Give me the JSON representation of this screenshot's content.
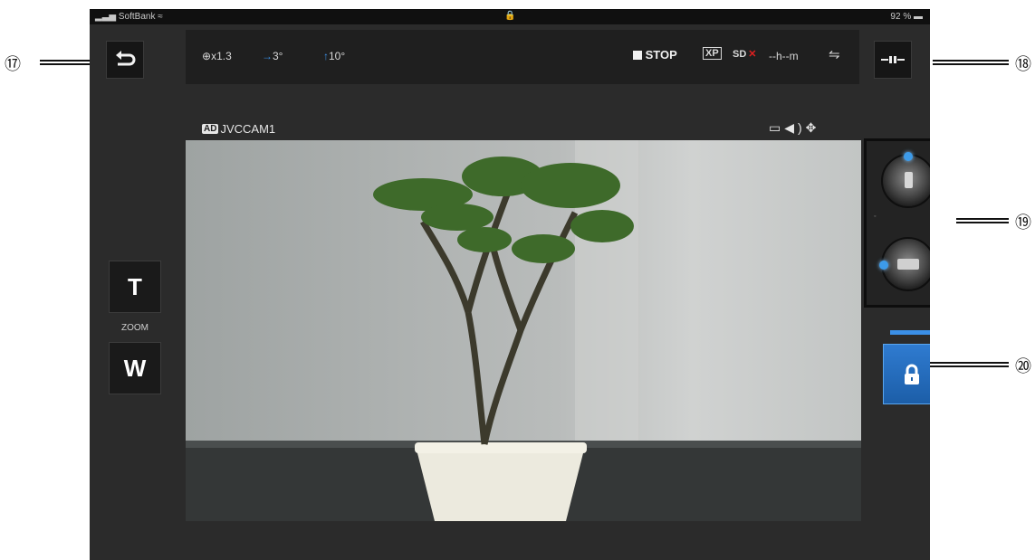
{
  "status_bar": {
    "carrier": "SoftBank",
    "battery": "92 %"
  },
  "toolbar": {
    "zoom": "x1.3",
    "pan": "3°",
    "tilt": "10°",
    "rec_state": "STOP",
    "rec_mode": "XP",
    "media": "SD",
    "remaining": "--h--m"
  },
  "camera": {
    "badge": "AD",
    "name": "JVCCAM1"
  },
  "zoom_control": {
    "tele_label": "T",
    "label": "ZOOM",
    "wide_label": "W"
  },
  "callouts": {
    "back": "⑰",
    "menu": "⑱",
    "dials": "⑲",
    "lock": "⑳"
  },
  "colors": {
    "accent": "#3b8fe6",
    "rec_x": "#e02020"
  }
}
